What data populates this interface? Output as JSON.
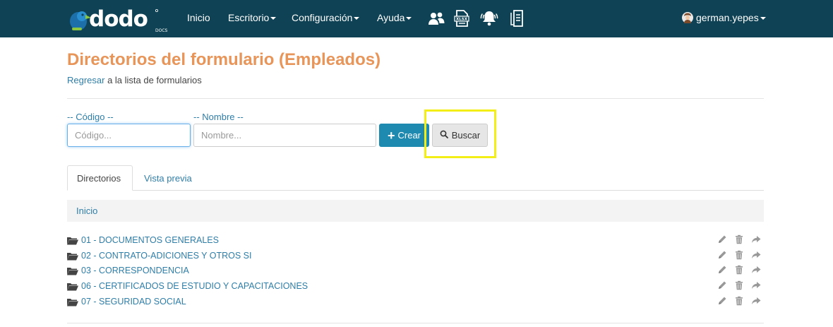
{
  "brand": {
    "logo_text": "dodo",
    "logo_sub": "DOCS",
    "colors": {
      "navbar": "#0e4254",
      "accent_green": "#8dc63f",
      "title_orange": "#e8955a",
      "link_blue": "#2f7ea8",
      "primary_button": "#1e8ab0",
      "highlight": "#f4ee17"
    }
  },
  "nav": {
    "items": [
      {
        "label": "Inicio",
        "dropdown": false
      },
      {
        "label": "Escritorio",
        "dropdown": true
      },
      {
        "label": "Configuración",
        "dropdown": true
      },
      {
        "label": "Ayuda",
        "dropdown": true
      }
    ],
    "icons": [
      "users-icon",
      "xlsx-file-icon",
      "bell-alert-icon",
      "document-list-icon"
    ],
    "user": "german.yepes"
  },
  "header": {
    "title": "Directorios del formulario (Empleados)",
    "back_link": "Regresar",
    "back_text": " a la lista de formularios"
  },
  "search": {
    "code_label": "-- Código --",
    "code_placeholder": "Código...",
    "name_label": "-- Nombre --",
    "name_placeholder": "Nombre...",
    "create_label": "Crear",
    "search_label": "Buscar"
  },
  "tabs": [
    {
      "label": "Directorios",
      "active": true
    },
    {
      "label": "Vista previa",
      "active": false
    }
  ],
  "breadcrumb": {
    "root": "Inicio"
  },
  "directories": [
    {
      "name": "01 - DOCUMENTOS GENERALES"
    },
    {
      "name": "02 - CONTRATO-ADICIONES Y OTROS SI"
    },
    {
      "name": "03 - CORRESPONDENCIA"
    },
    {
      "name": "06 - CERTIFICADOS DE ESTUDIO Y CAPACITACIONES"
    },
    {
      "name": "07 - SEGURIDAD SOCIAL"
    }
  ],
  "row_action_icons": [
    "pencil-icon",
    "trash-icon",
    "share-arrow-icon"
  ]
}
